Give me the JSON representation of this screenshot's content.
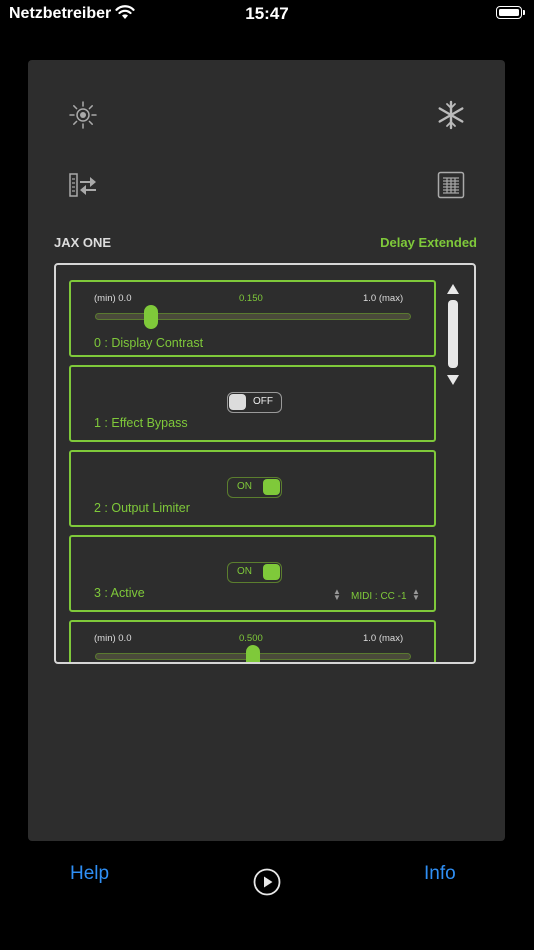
{
  "status_bar": {
    "carrier": "Netzbetreiber",
    "time": "15:47"
  },
  "header": {
    "device": "JAX ONE",
    "preset": "Delay Extended"
  },
  "toolbar_icons": [
    "sun-icon",
    "snowflake-icon",
    "transfer-icon",
    "list-view-icon"
  ],
  "parameters": [
    {
      "kind": "slider",
      "name": "0 : Display Contrast",
      "min_label": "(min) 0.0",
      "value": "0.150",
      "max_label": "1.0  (max)",
      "fraction": 0.15
    },
    {
      "kind": "toggle",
      "name": "1 : Effect Bypass",
      "state": "OFF"
    },
    {
      "kind": "toggle",
      "name": "2 : Output Limiter",
      "state": "ON"
    },
    {
      "kind": "toggle",
      "name": "3 : Active",
      "state": "ON",
      "midi": "MIDI : CC -1"
    },
    {
      "kind": "slider",
      "name": "",
      "min_label": "(min) 0.0",
      "value": "0.500",
      "max_label": "1.0  (max)",
      "fraction": 0.5
    }
  ],
  "tabbar": {
    "help": "Help",
    "info": "Info"
  },
  "colors": {
    "accent": "#7fc93a",
    "link": "#2f8ff5",
    "panel": "#2d2d2d"
  }
}
